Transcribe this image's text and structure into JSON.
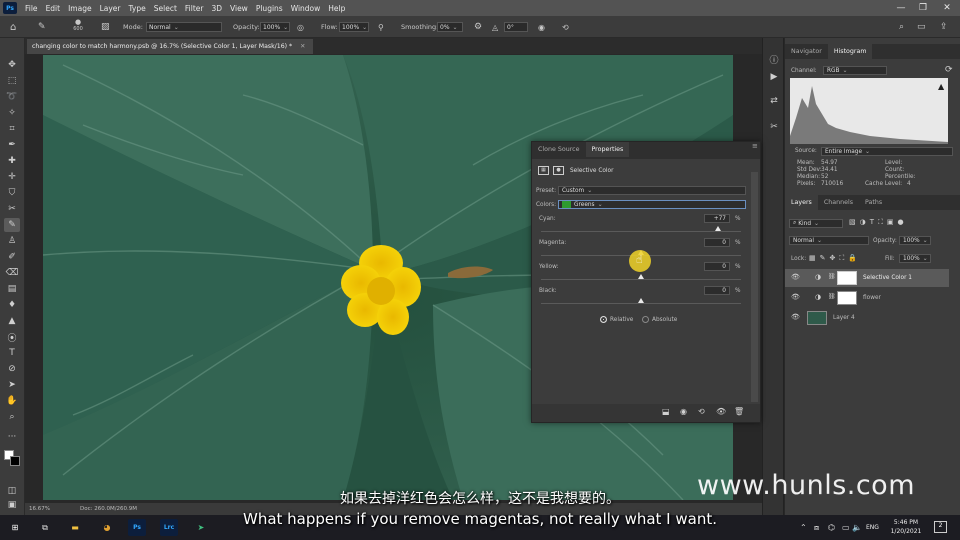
{
  "menubar": {
    "app_logo": "Ps",
    "items": [
      "File",
      "Edit",
      "Image",
      "Layer",
      "Type",
      "Select",
      "Filter",
      "3D",
      "View",
      "Plugins",
      "Window",
      "Help"
    ]
  },
  "options": {
    "brush_size": "600",
    "mode_label": "Mode:",
    "mode_value": "Normal",
    "opacity_label": "Opacity:",
    "opacity_value": "100%",
    "flow_label": "Flow:",
    "flow_value": "100%",
    "smoothing_label": "Smoothing:",
    "smoothing_value": "0%",
    "angle_value": "0°"
  },
  "document": {
    "tab_title": "changing color to match harmony.psb @ 16.7% (Selective Color 1, Layer Mask/16) *",
    "zoom": "16.67%",
    "doc_size": "Doc: 260.0M/260.9M"
  },
  "navigator": {
    "tabs": [
      "Navigator",
      "Histogram"
    ],
    "channel_label": "Channel:",
    "channel_value": "RGB",
    "source_label": "Source:",
    "source_value": "Entire Image",
    "stats": [
      {
        "k": "Mean:",
        "v": "54.97"
      },
      {
        "k": "Std Dev:",
        "v": "34.41"
      },
      {
        "k": "Median:",
        "v": "52"
      },
      {
        "k": "Pixels:",
        "v": "710016"
      }
    ],
    "stats2": [
      {
        "k": "Level:",
        "v": ""
      },
      {
        "k": "Count:",
        "v": ""
      },
      {
        "k": "Percentile:",
        "v": ""
      },
      {
        "k": "Cache Level:",
        "v": "4"
      }
    ]
  },
  "layers": {
    "tabs": [
      "Layers",
      "Channels",
      "Paths"
    ],
    "filter_value": "Kind",
    "blend_value": "Normal",
    "opacity_label": "Opacity:",
    "opacity_value": "100%",
    "lock_label": "Lock:",
    "fill_label": "Fill:",
    "fill_value": "100%",
    "items": [
      {
        "name": "Selective Color 1"
      },
      {
        "name": "flower"
      },
      {
        "name": "Layer 4"
      }
    ]
  },
  "properties": {
    "tabs": [
      "Clone Source",
      "Properties"
    ],
    "title": "Selective Color",
    "preset_label": "Preset:",
    "preset_value": "Custom",
    "colors_label": "Colors:",
    "colors_value": "Greens",
    "colors_swatch": "#2e9b2e",
    "sliders": [
      {
        "label": "Cyan:",
        "value": "+77",
        "pct": "%",
        "pos": 0.885
      },
      {
        "label": "Magenta:",
        "value": "0",
        "pct": "%",
        "pos": 0.5
      },
      {
        "label": "Yellow:",
        "value": "0",
        "pct": "%",
        "pos": 0.5
      },
      {
        "label": "Black:",
        "value": "0",
        "pct": "%",
        "pos": 0.5
      }
    ],
    "method_relative": "Relative",
    "method_absolute": "Absolute"
  },
  "taskbar": {
    "lang": "ENG",
    "time": "5:46 PM",
    "date": "1/20/2021",
    "notif": "2"
  },
  "overlay": {
    "subtitle_cn": "如果去掉洋红色会怎么样，这不是我想要的。",
    "subtitle_en": "What happens if you remove magentas, not really what I want.",
    "watermark": "www.hunls.com"
  },
  "colors": {
    "accent": "#31a8ff",
    "leaf": "#2f5a4a",
    "flower": "#f4d000"
  }
}
